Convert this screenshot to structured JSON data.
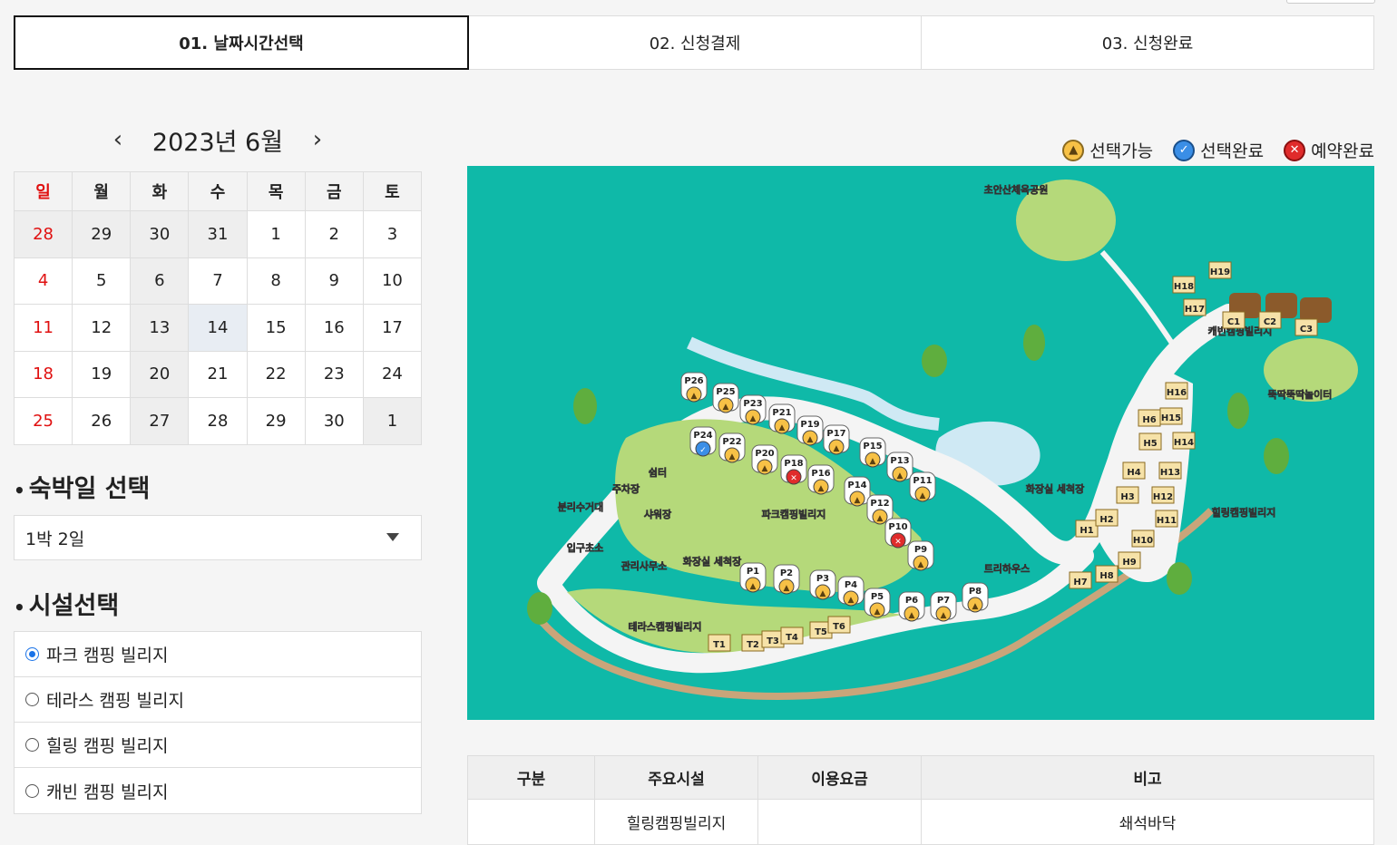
{
  "steps": [
    {
      "label": "01. 날짜시간선택",
      "active": true
    },
    {
      "label": "02. 신청결제",
      "active": false
    },
    {
      "label": "03. 신청완료",
      "active": false
    }
  ],
  "calendar": {
    "title": "2023년 6월",
    "prev_icon": "chevron-left-icon",
    "next_icon": "chevron-right-icon",
    "weekdays": [
      "일",
      "월",
      "화",
      "수",
      "목",
      "금",
      "토"
    ],
    "weeks": [
      [
        "28",
        "29",
        "30",
        "31",
        "1",
        "2",
        "3"
      ],
      [
        "4",
        "5",
        "6",
        "7",
        "8",
        "9",
        "10"
      ],
      [
        "11",
        "12",
        "13",
        "14",
        "15",
        "16",
        "17"
      ],
      [
        "18",
        "19",
        "20",
        "21",
        "22",
        "23",
        "24"
      ],
      [
        "25",
        "26",
        "27",
        "28",
        "29",
        "30",
        "1"
      ]
    ],
    "selected_date": "14"
  },
  "stay": {
    "title": "숙박일 선택",
    "selected": "1박 2일"
  },
  "facility": {
    "title": "시설선택",
    "options": [
      "파크 캠핑 빌리지",
      "테라스 캠핑 빌리지",
      "힐링 캠핑 빌리지",
      "캐빈 캠핑 빌리지"
    ],
    "selected": "파크 캠핑 빌리지"
  },
  "legend": {
    "available": "선택가능",
    "selected": "선택완료",
    "reserved": "예약완료",
    "colors": {
      "available": "#f7c146",
      "selected": "#3a8ee6",
      "reserved": "#e02b2b"
    }
  },
  "map": {
    "labels": {
      "park_village": "파크캠핑빌리지",
      "terrace_village": "테라스캠핑빌리지",
      "healing_village": "힐링캠핑빌리지",
      "cabin_village": "캐빈캠핑빌리지",
      "sports_park": "초안산체육공원",
      "playground": "뚝딱뚝딱놀이터",
      "management_office": "관리사무소",
      "parking": "주차장",
      "restroom_washroom": "화장실 세척장",
      "restroom_washroom_2": "화장실 세척장",
      "shower": "샤워장",
      "tree_house": "트리하우스",
      "recycling": "분리수거대",
      "entrance": "입구초소",
      "shelter": "쉼터"
    },
    "park_sites": {
      "available": [
        "P26",
        "P25",
        "P23",
        "P21",
        "P19",
        "P17",
        "P15",
        "P13",
        "P11",
        "P22",
        "P20",
        "P16",
        "P14",
        "P12",
        "P9",
        "P1",
        "P2",
        "P3",
        "P4",
        "P5",
        "P6",
        "P7",
        "P8"
      ],
      "selected": [
        "P24"
      ],
      "reserved": [
        "P18",
        "P10"
      ]
    },
    "terrace_sites": [
      "T1",
      "T2",
      "T3",
      "T4",
      "T5",
      "T6"
    ],
    "healing_sites": [
      "H1",
      "H2",
      "H3",
      "H4",
      "H5",
      "H6",
      "H7",
      "H8",
      "H9",
      "H10",
      "H11",
      "H12",
      "H13",
      "H14",
      "H15",
      "H16",
      "H17",
      "H18",
      "H19"
    ],
    "cabin_sites": [
      "C1",
      "C2",
      "C3"
    ]
  },
  "info_table": {
    "headers": [
      "구분",
      "주요시설",
      "이용요금",
      "비고"
    ],
    "row1": {
      "facility": "힐링캠핑빌리지",
      "note": "쇄석바닥"
    }
  }
}
